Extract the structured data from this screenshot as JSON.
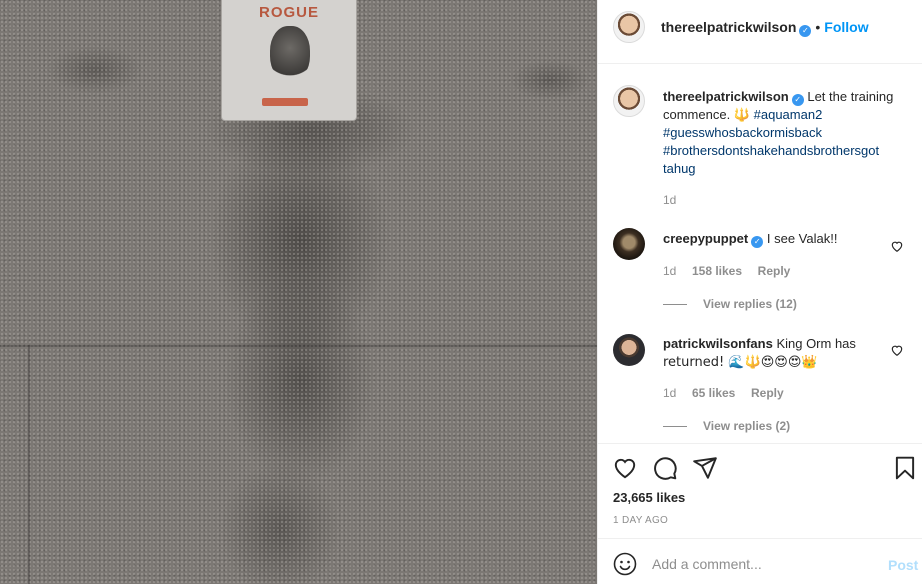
{
  "photo": {
    "pad_brand": "ROGUE"
  },
  "header": {
    "username": "thereelpatrickwilson",
    "separator": "•",
    "follow_label": "Follow"
  },
  "caption": {
    "username": "thereelpatrickwilson",
    "text": "Let the training commence. 🔱",
    "hashtags": [
      "#aquaman2",
      "#guesswhosbackormisback",
      "#brothersdontshakehandsbrothersgot",
      "tahug"
    ],
    "time": "1d"
  },
  "comments": [
    {
      "username": "creepypuppet",
      "verified": true,
      "text": "I see Valak!!",
      "time": "1d",
      "likes": "158 likes",
      "reply_label": "Reply",
      "view_replies": "View replies (12)"
    },
    {
      "username": "patrickwilsonfans",
      "verified": false,
      "text": "King Orm has",
      "text_line2": "returned! 🌊🔱😍😍😍👑",
      "time": "1d",
      "likes": "65 likes",
      "reply_label": "Reply",
      "view_replies": "View replies (2)"
    }
  ],
  "actions": {
    "like_icon": "heart-icon",
    "comment_icon": "comment-icon",
    "share_icon": "share-icon",
    "save_icon": "bookmark-icon"
  },
  "stats": {
    "likes": "23,665 likes",
    "date": "1 DAY AGO"
  },
  "composer": {
    "placeholder": "Add a comment...",
    "post_label": "Post"
  },
  "colors": {
    "accent": "#0095f6",
    "verified": "#3897f0",
    "hashtag": "#00376b",
    "muted": "#8e8e8e"
  }
}
